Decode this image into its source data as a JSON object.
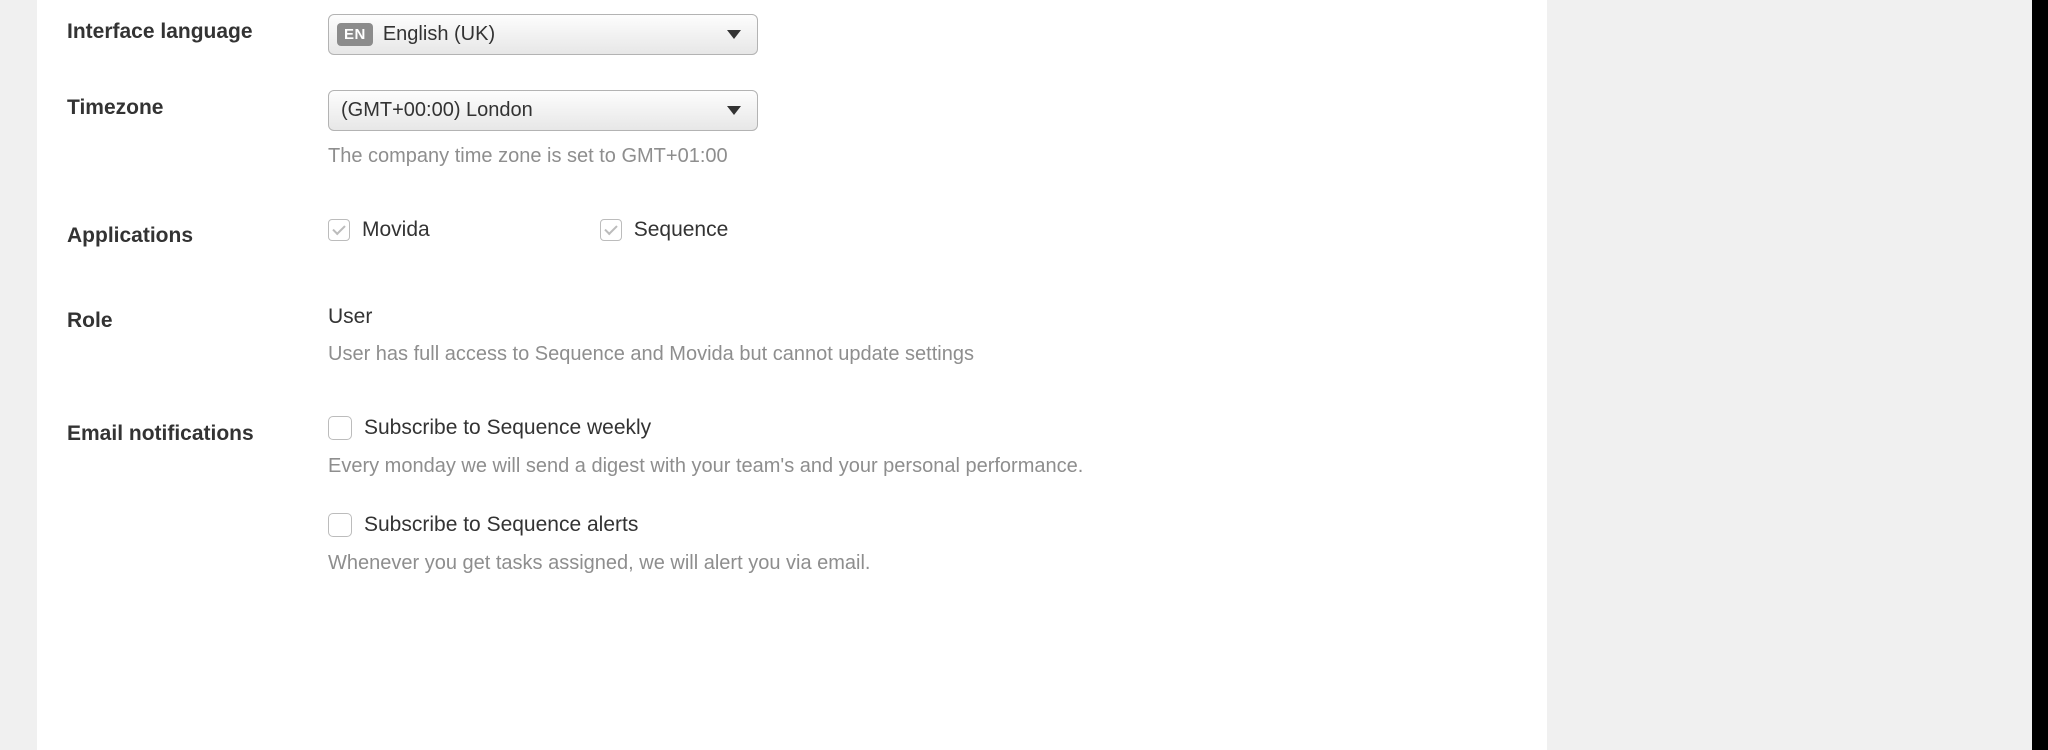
{
  "labels": {
    "interface_language": "Interface language",
    "timezone": "Timezone",
    "applications": "Applications",
    "role": "Role",
    "email_notifications": "Email notifications"
  },
  "language": {
    "badge": "EN",
    "value": "English (UK)"
  },
  "timezone": {
    "value": "(GMT+00:00) London",
    "hint": "The company time zone is set to GMT+01:00"
  },
  "applications": {
    "movida": "Movida",
    "sequence": "Sequence"
  },
  "role": {
    "value": "User",
    "hint": "User has full access to Sequence and Movida but cannot update settings"
  },
  "notifications": {
    "weekly": {
      "title": "Subscribe to Sequence weekly",
      "desc": "Every monday we will send a digest with your team's and your personal performance."
    },
    "alerts": {
      "title": "Subscribe to Sequence alerts",
      "desc": "Whenever you get tasks assigned, we will alert you via email."
    }
  }
}
